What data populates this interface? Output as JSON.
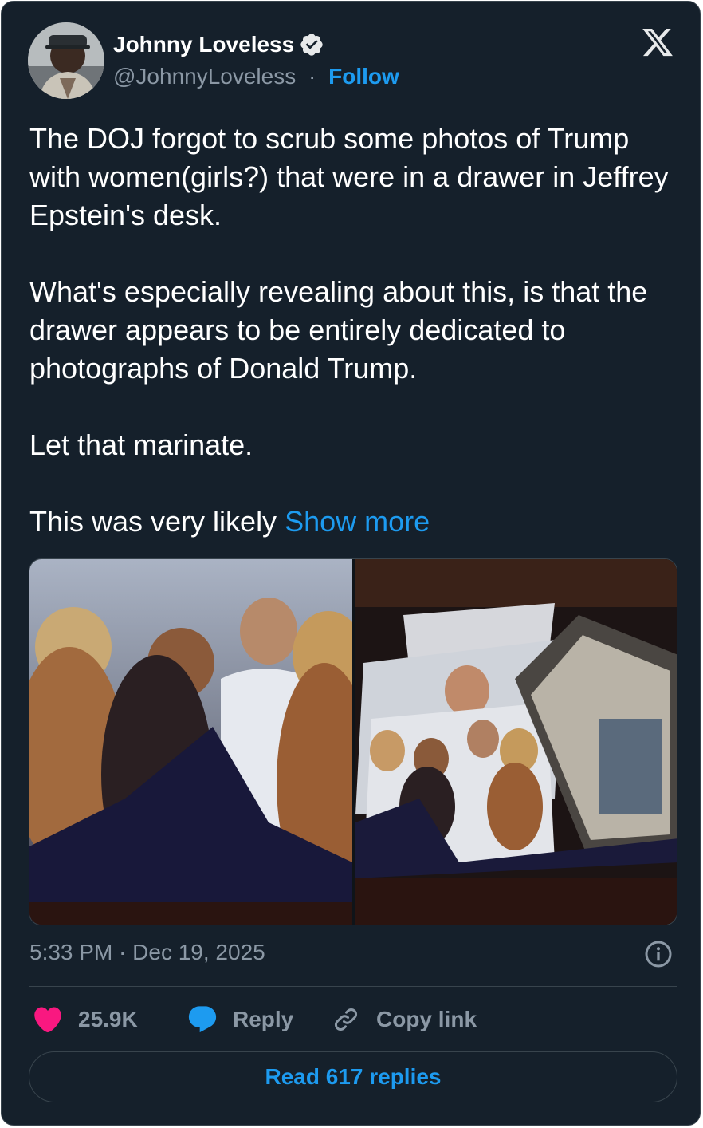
{
  "author": {
    "name": "Johnny Loveless",
    "handle": "@JohnnyLoveless",
    "separator": "·",
    "follow_label": "Follow",
    "verified": true
  },
  "tweet": {
    "paragraphs": [
      "The DOJ forgot to scrub some photos of Trump with women(girls?) that were in a drawer in Jeffrey Epstein's desk.",
      "What's especially revealing about this, is that the drawer appears to be entirely dedicated to photographs of Donald Trump.",
      "Let that marinate."
    ],
    "truncated_text": "This was very likely ",
    "show_more_label": "Show more",
    "timestamp": "5:33 PM · Dec 19, 2025"
  },
  "actions": {
    "likes": "25.9K",
    "reply_label": "Reply",
    "copy_link_label": "Copy link",
    "read_replies_label": "Read 617 replies"
  },
  "icons": {
    "logo": "x-logo-icon",
    "verified": "verified-badge-icon",
    "info": "info-icon",
    "like": "heart-icon",
    "reply": "speech-bubble-icon",
    "copy": "link-icon"
  },
  "colors": {
    "background": "#15202b",
    "accent": "#1d9bf0",
    "like": "#f91880",
    "secondary_text": "#8b98a5",
    "border": "#38444d"
  }
}
